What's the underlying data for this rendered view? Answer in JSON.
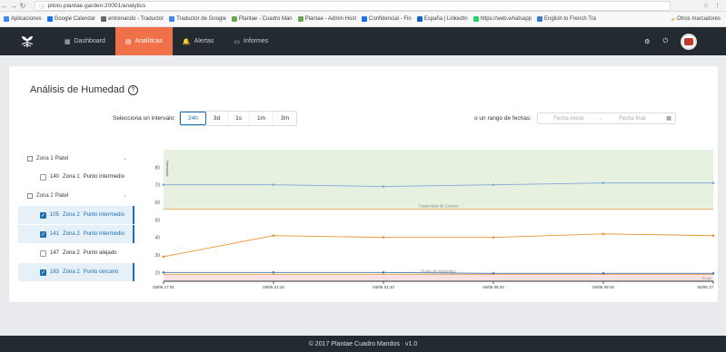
{
  "browser": {
    "url": "piloto.plantae.garden:20001/analytics",
    "bookmarks": [
      {
        "label": "Aplicaciones",
        "color": "#4285f4"
      },
      {
        "label": "Google Calendar",
        "color": "#1a73e8"
      },
      {
        "label": "entrenando - Traductor",
        "color": "#666666"
      },
      {
        "label": "Traductor de Google",
        "color": "#4285f4"
      },
      {
        "label": "Plantae - Cuadro Man",
        "color": "#6aa84f"
      },
      {
        "label": "Plantae - Admin Host",
        "color": "#6aa84f"
      },
      {
        "label": "Confidencial - Fin",
        "color": "#1a73e8"
      },
      {
        "label": "España | LinkedIn",
        "color": "#0a66c2"
      },
      {
        "label": "https://web.whatsapp",
        "color": "#25d366"
      },
      {
        "label": "English to French Tra",
        "color": "#3c78d8"
      }
    ],
    "other_bookmarks": "Otros marcadores"
  },
  "nav": {
    "items": [
      {
        "label": "Dashboard",
        "icon": "dashboard-icon",
        "glyph": "▦",
        "active": false
      },
      {
        "label": "Analíticas",
        "icon": "chart-icon",
        "glyph": "▤",
        "active": true
      },
      {
        "label": "Alertas",
        "icon": "bell-icon",
        "glyph": "🔔",
        "active": false
      },
      {
        "label": "Informes",
        "icon": "document-icon",
        "glyph": "▭",
        "active": false
      }
    ]
  },
  "page": {
    "title": "Análisis de Humedad"
  },
  "interval": {
    "label": "Selecciona un intervalo:",
    "options": [
      "24h",
      "3d",
      "1s",
      "1m",
      "3m"
    ],
    "active": "24h"
  },
  "date_range": {
    "label": "o un rango de fechas:",
    "from_placeholder": "Fecha inicial",
    "to_placeholder": "Fecha final"
  },
  "sensors": {
    "groups": [
      {
        "label": "Zona 1 Platel",
        "items": [
          {
            "id": "140",
            "zone": "Zona 1",
            "name": "Punto intermedio",
            "checked": false
          }
        ]
      },
      {
        "label": "Zona 2 Platel",
        "items": [
          {
            "id": "105",
            "zone": "Zona 2",
            "name": "Punto intermedio",
            "checked": true
          },
          {
            "id": "141",
            "zone": "Zona 2",
            "name": "Punto intermedio",
            "checked": true
          },
          {
            "id": "147",
            "zone": "Zona 2",
            "name": "Punto alejado",
            "checked": false
          },
          {
            "id": "163",
            "zone": "Zona 2",
            "name": "Punto cercano",
            "checked": true
          }
        ]
      }
    ]
  },
  "chart_data": {
    "type": "line",
    "ylabel": "Humedad",
    "ylim": [
      15,
      90
    ],
    "yticks": [
      20,
      30,
      40,
      50,
      60,
      70,
      80
    ],
    "x": [
      "03/05 17:01",
      "03/05 21:10",
      "04/05 01:10",
      "04/05 05:10",
      "04/05 09:10",
      "04/05 17"
    ],
    "series": [
      {
        "name": "",
        "color": "#7fa8d8",
        "values": [
          70,
          70,
          69,
          70,
          71,
          71
        ]
      },
      {
        "name": "",
        "color": "#e89430",
        "values": [
          29,
          41,
          40,
          40,
          42,
          41
        ]
      },
      {
        "name": "",
        "color": "#3d7aa8",
        "values": [
          20,
          20,
          20,
          19.5,
          19.5,
          19.5
        ]
      }
    ],
    "bands": [
      {
        "label": "",
        "from": 56,
        "to": 90,
        "color": "#e6f2df"
      },
      {
        "label": "",
        "from": 15,
        "to": 19,
        "color": "#fbe2e2"
      }
    ],
    "threshold_lines": [
      {
        "label": "Capacidad de Campo",
        "value": 56,
        "color": "#e89430"
      },
      {
        "label": "Punto de Marchitez",
        "value": 19,
        "color": "#e89430"
      }
    ],
    "corner_label": "Riego"
  },
  "footer": {
    "text": "© 2017 Plantae Cuadro Mandos · v1.0"
  }
}
